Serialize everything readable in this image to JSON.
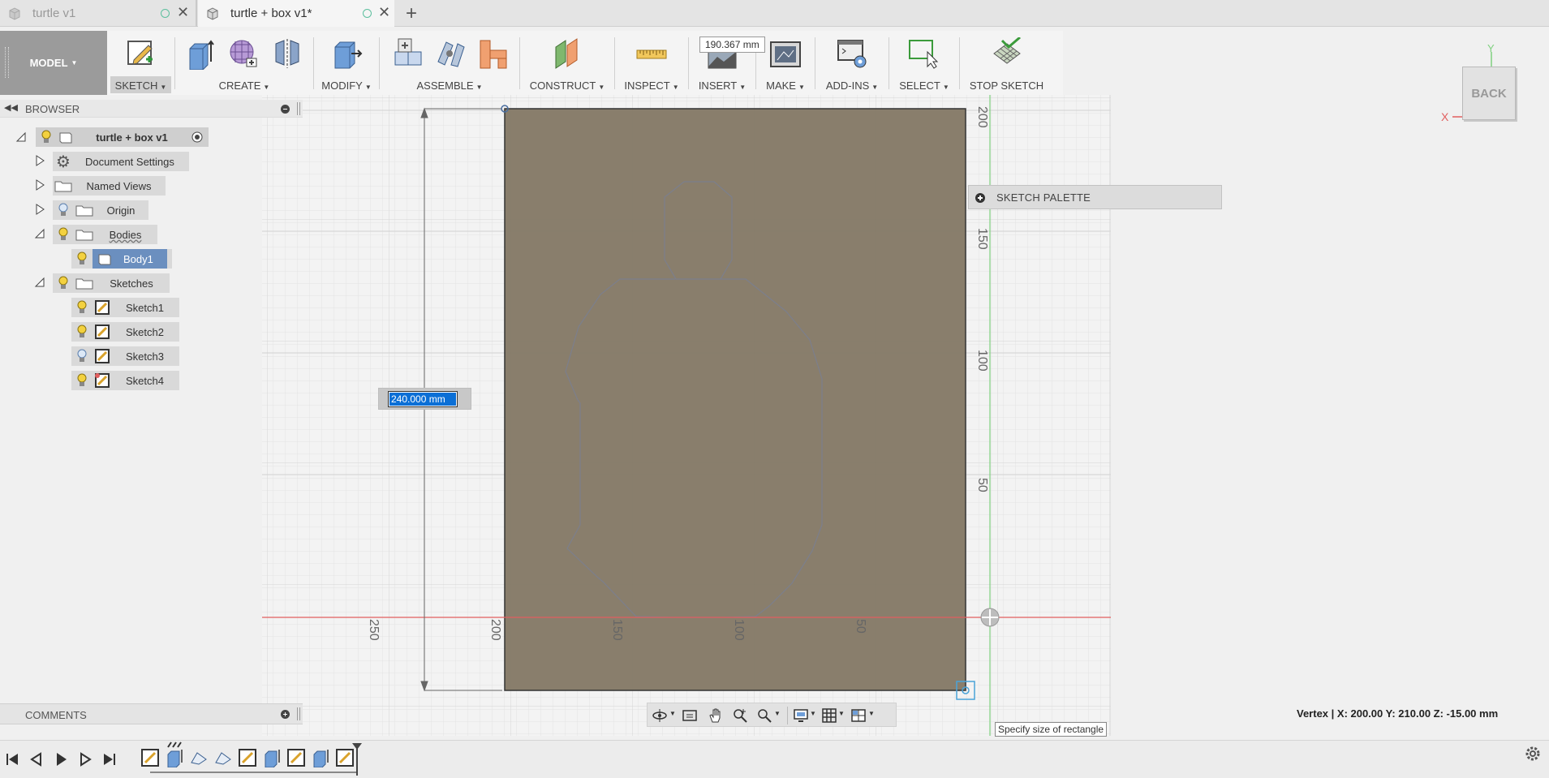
{
  "tabs": [
    {
      "title": "turtle v1",
      "active": false
    },
    {
      "title": "turtle + box v1*",
      "active": true
    }
  ],
  "toolbar": {
    "workspace": "MODEL",
    "groups": [
      {
        "label": "SKETCH"
      },
      {
        "label": "CREATE"
      },
      {
        "label": "MODIFY"
      },
      {
        "label": "ASSEMBLE"
      },
      {
        "label": "CONSTRUCT"
      },
      {
        "label": "INSPECT"
      },
      {
        "label": "INSERT"
      },
      {
        "label": "MAKE"
      },
      {
        "label": "ADD-INS"
      },
      {
        "label": "SELECT"
      },
      {
        "label": "STOP SKETCH"
      }
    ],
    "measure_tooltip": "190.367 mm"
  },
  "browser": {
    "title": "BROWSER",
    "root": "turtle + box v1",
    "items": [
      {
        "label": "Document Settings"
      },
      {
        "label": "Named Views"
      },
      {
        "label": "Origin"
      },
      {
        "label": "Bodies"
      },
      {
        "label": "Body1"
      },
      {
        "label": "Sketches"
      },
      {
        "label": "Sketch1"
      },
      {
        "label": "Sketch2"
      },
      {
        "label": "Sketch3"
      },
      {
        "label": "Sketch4"
      }
    ]
  },
  "comments": {
    "title": "COMMENTS"
  },
  "sketch_palette": {
    "title": "SKETCH PALETTE"
  },
  "viewcube": {
    "face": "BACK",
    "axis_y": "Y",
    "axis_x": "X"
  },
  "dimension_input": {
    "value": "240.000 mm"
  },
  "ruler": {
    "vertical": [
      "200",
      "150",
      "100",
      "50"
    ],
    "horizontal": [
      "250",
      "200",
      "150",
      "100",
      "50"
    ]
  },
  "status": {
    "vertex": "Vertex | X: 200.00 Y: 210.00 Z: -15.00 mm",
    "hint": "Specify size of rectangle"
  },
  "colors": {
    "rect_fill": "#877b69",
    "x_axis": "#e15f5f",
    "y_axis": "#7fd07f",
    "selected": "#6b8fbf"
  }
}
